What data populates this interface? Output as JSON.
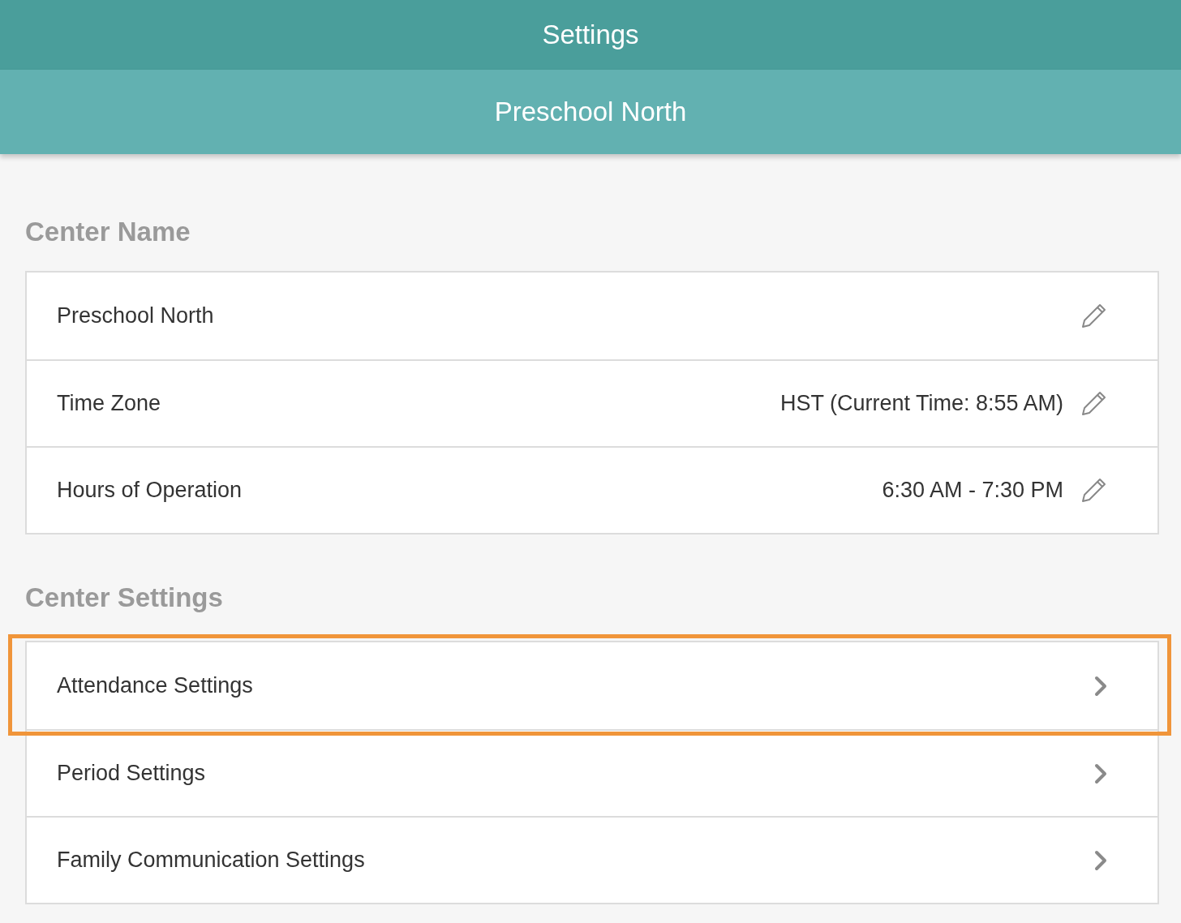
{
  "header": {
    "title": "Settings",
    "subtitle": "Preschool North"
  },
  "sections": [
    {
      "heading": "Center Name",
      "items": [
        {
          "kind": "edit",
          "label": "Preschool North",
          "highlighted": false
        },
        {
          "kind": "edit",
          "label": "Time Zone",
          "value": "HST (Current Time: 8:55 AM)",
          "highlighted": false
        },
        {
          "kind": "edit",
          "label": "Hours of Operation",
          "value": "6:30 AM - 7:30 PM",
          "highlighted": false
        }
      ]
    },
    {
      "heading": "Center Settings",
      "items": [
        {
          "kind": "link",
          "label": "Attendance Settings",
          "highlighted": true
        },
        {
          "kind": "link",
          "label": "Period Settings",
          "highlighted": false
        },
        {
          "kind": "link",
          "label": "Family Communication Settings",
          "highlighted": false
        }
      ]
    }
  ]
}
